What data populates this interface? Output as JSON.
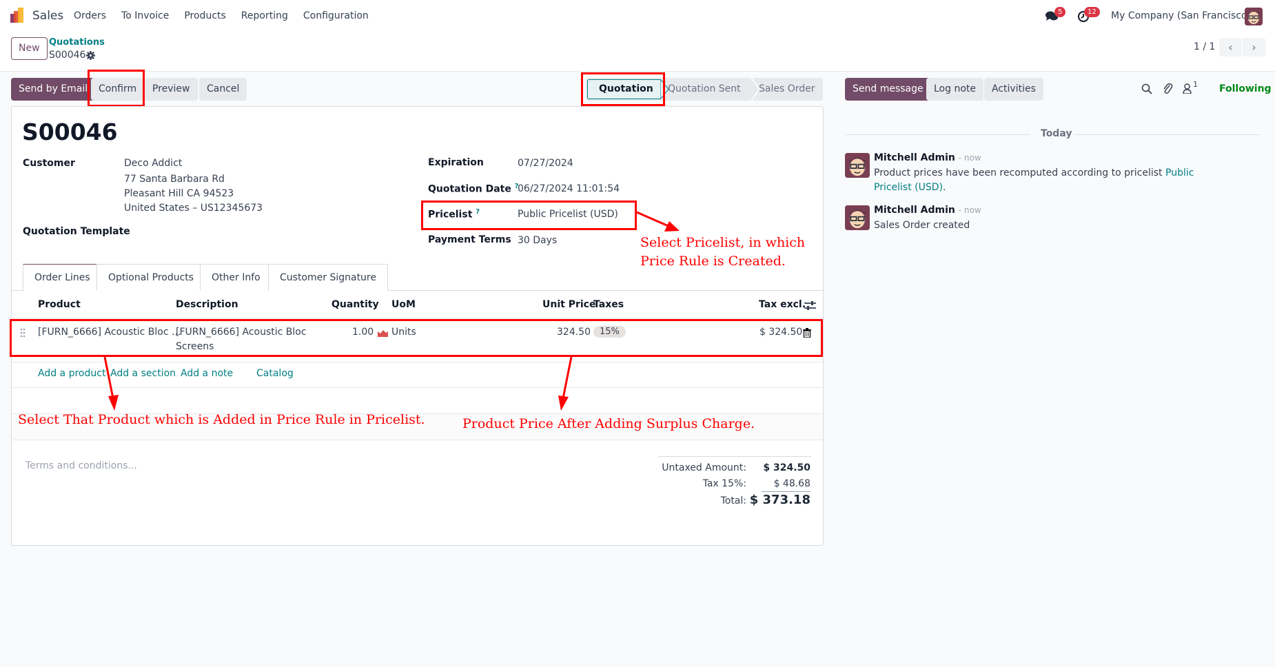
{
  "navbar": {
    "app_name": "Sales",
    "menu": [
      "Orders",
      "To Invoice",
      "Products",
      "Reporting",
      "Configuration"
    ],
    "messages_badge": "5",
    "activities_badge": "12",
    "company": "My Company (San Francisco)"
  },
  "control_panel": {
    "new_label": "New",
    "breadcrumb_parent": "Quotations",
    "breadcrumb_current": "S00046",
    "pager_value": "1 / 1"
  },
  "actions": {
    "send_by_email": "Send by Email",
    "confirm": "Confirm",
    "preview": "Preview",
    "cancel": "Cancel"
  },
  "statusbar": {
    "stages": [
      "Quotation",
      "Quotation Sent",
      "Sales Order"
    ],
    "active": "Quotation"
  },
  "form": {
    "title": "S00046",
    "customer_label": "Customer",
    "customer_name": "Deco Addict",
    "customer_address": [
      "77 Santa Barbara Rd",
      "Pleasant Hill CA 94523",
      "United States – US12345673"
    ],
    "quotation_template_label": "Quotation Template",
    "expiration_label": "Expiration",
    "expiration_value": "07/27/2024",
    "quotation_date_label": "Quotation Date",
    "quotation_date_value": "06/27/2024 11:01:54",
    "pricelist_label": "Pricelist",
    "pricelist_value": "Public Pricelist (USD)",
    "payment_terms_label": "Payment Terms",
    "payment_terms_value": "30 Days",
    "help_mark": "?"
  },
  "tabs": [
    "Order Lines",
    "Optional Products",
    "Other Info",
    "Customer Signature"
  ],
  "order_lines": {
    "columns": [
      "Product",
      "Description",
      "Quantity",
      "UoM",
      "Unit Price",
      "Taxes",
      "Tax excl."
    ],
    "rows": [
      {
        "product": "[FURN_6666] Acoustic Bloc ...",
        "description_line1": "[FURN_6666] Acoustic Bloc",
        "description_line2": "Screens",
        "quantity": "1.00",
        "uom": "Units",
        "unit_price": "324.50",
        "taxes": "15%",
        "subtotal": "$ 324.50"
      }
    ],
    "add_product": "Add a product",
    "add_section": "Add a section",
    "add_note": "Add a note",
    "catalog": "Catalog"
  },
  "terms_placeholder": "Terms and conditions...",
  "totals": {
    "untaxed_label": "Untaxed Amount:",
    "untaxed_value": "$ 324.50",
    "tax_label": "Tax 15%:",
    "tax_value": "$ 48.68",
    "total_label": "Total:",
    "total_value": "$ 373.18"
  },
  "chatter": {
    "send_message": "Send message",
    "log_note": "Log note",
    "activities": "Activities",
    "followers_count": "1",
    "following": "Following",
    "date_separator": "Today",
    "messages": [
      {
        "author": "Mitchell Admin",
        "time": "- now",
        "body_prefix": "Product prices have been recomputed according to pricelist ",
        "body_link": "Public Pricelist (USD)",
        "body_suffix": "."
      },
      {
        "author": "Mitchell Admin",
        "time": "- now",
        "body_prefix": "Sales Order created",
        "body_link": "",
        "body_suffix": ""
      }
    ]
  },
  "annotations": {
    "pricelist_note_line1": "Select Pricelist, in which",
    "pricelist_note_line2": "Price Rule is Created.",
    "product_note": "Select That Product which is Added in Price Rule in Pricelist.",
    "price_note": "Product Price After Adding Surplus Charge."
  },
  "colors": {
    "brand": "#714b67",
    "link": "#017e84",
    "annotation": "#ff0000",
    "following": "#008818",
    "badge": "#dc3545"
  }
}
